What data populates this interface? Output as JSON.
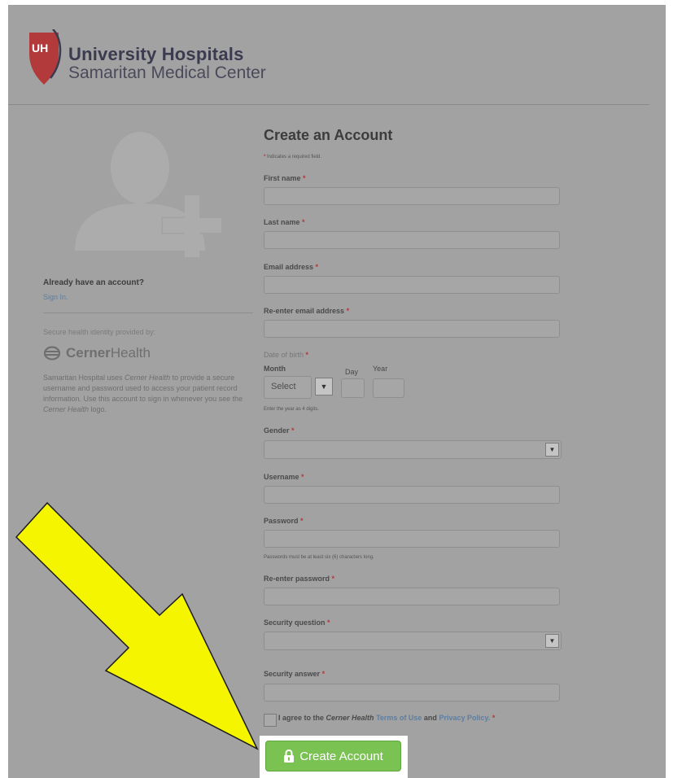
{
  "brand": {
    "line1": "University Hospitals",
    "line2": "Samaritan Medical Center",
    "logo_letters": "UH",
    "accent_color": "#b23a3a"
  },
  "sidebar": {
    "already_label": "Already have an account?",
    "signin_link": "Sign In.",
    "secure_label": "Secure health identity provided by:",
    "cerner_bold": "Cerner",
    "cerner_regular": "Health",
    "description_parts": [
      "Samaritan Hospital uses ",
      "Cerner Health",
      " to provide a secure username and password used to access your patient record information. Use this account to sign in whenever you see the ",
      "Cerner Health",
      " logo."
    ]
  },
  "form": {
    "title": "Create an Account",
    "required_note": "Indicates a required field.",
    "required_marker": "*",
    "fields": {
      "first_name": "First name",
      "last_name": "Last name",
      "email": "Email address",
      "reenter_email": "Re-enter email address",
      "dob": "Date of birth",
      "month": "Month",
      "day": "Day",
      "year": "Year",
      "month_value": "Select",
      "year_note": "Enter the year as 4 digits.",
      "gender": "Gender",
      "username": "Username",
      "password": "Password",
      "password_note": "Passwords must be at least six (6) characters long.",
      "reenter_password": "Re-enter password",
      "security_question": "Security question",
      "security_answer": "Security answer"
    },
    "agree": {
      "prefix": "I agree to the ",
      "brand": "Cerner Health",
      "terms": "Terms of Use",
      "and": " and ",
      "privacy": "Privacy Policy."
    },
    "submit_label": "Create Account"
  },
  "annotation": {
    "arrow_color": "#f5f500",
    "arrow_outline": "#1a1a1a"
  }
}
